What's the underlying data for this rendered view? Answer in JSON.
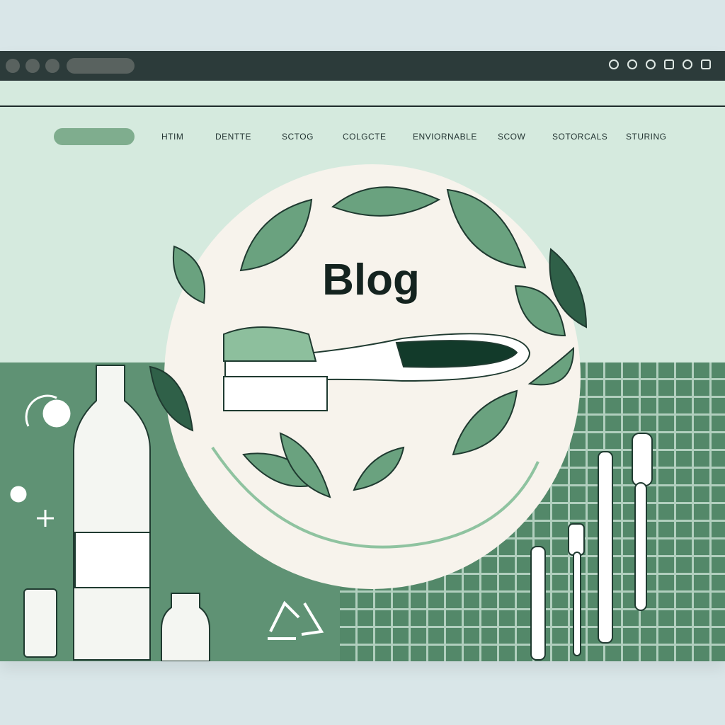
{
  "window": {
    "controls": [
      "close",
      "minimize",
      "maximize"
    ],
    "toolbar_icons": [
      "circle-icon",
      "shield-icon",
      "bell-icon",
      "extension-icon",
      "music-icon",
      "menu-icon"
    ]
  },
  "nav": {
    "items": [
      "HTIM",
      "DENTTE",
      "SCTOG",
      "COLGCTE",
      "ENVIORNABLE",
      "SCOW",
      "SOTORCALS",
      "STURING"
    ]
  },
  "hero": {
    "title": "Blog"
  },
  "colors": {
    "chrome": "#2c3b3a",
    "page": "#d5eade",
    "band": "#5f9274",
    "leaf": "#6aa27f",
    "leaf_dark": "#1f4f3a",
    "circle": "#f7f3ec"
  }
}
